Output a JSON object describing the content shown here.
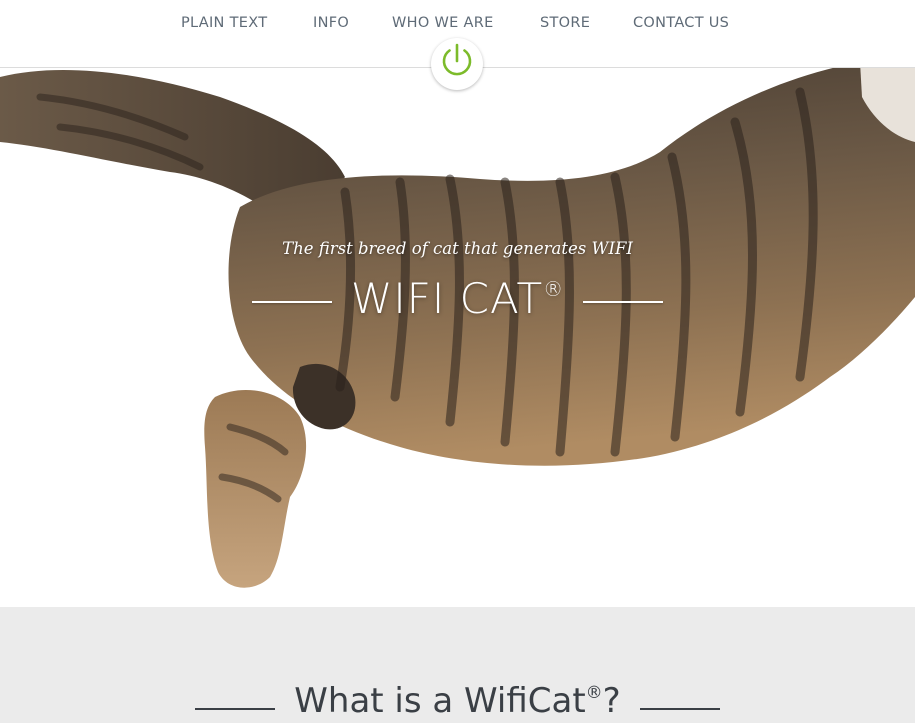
{
  "nav": {
    "items": [
      {
        "label": "PLAIN TEXT"
      },
      {
        "label": "INFO"
      },
      {
        "label": "WHO WE ARE"
      },
      {
        "label": "STORE"
      },
      {
        "label": "CONTACT US"
      }
    ],
    "power_icon": "power-icon",
    "accent_color": "#7cbb2a"
  },
  "hero": {
    "tagline": "The first breed of cat that generates WIFI",
    "title": "WIFI CAT",
    "title_mark": "®",
    "image": "tabby-cat-photo"
  },
  "info": {
    "title": "What is a WifiCat",
    "title_mark": "®",
    "title_suffix": "?"
  }
}
